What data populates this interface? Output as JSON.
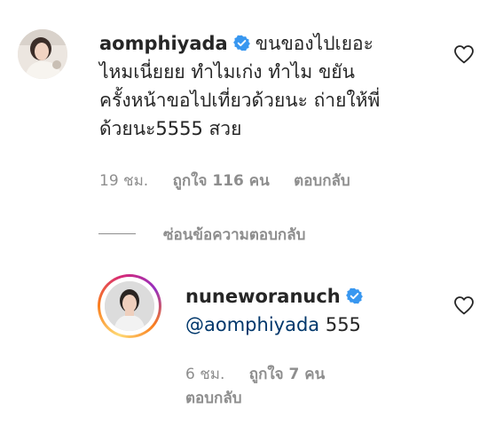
{
  "comment": {
    "username": "aomphiyada",
    "text_line1": "ขนของไปเยอะ",
    "text_line2": "ไหมเนี่ยยย ทำไมเก่ง ทำไม ขยัน",
    "text_line3": "ครั้งหน้าขอไปเที่ยวด้วยนะ ถ่ายให้พี่",
    "text_line4": "ด้วยนะ5555 สวย",
    "time": "19 ชม.",
    "likes": "ถูกใจ 116 คน",
    "reply_label": "ตอบกลับ"
  },
  "hide_replies_label": "ซ่อนข้อความตอบกลับ",
  "reply": {
    "username": "nuneworanuch",
    "mention": "@aomphiyada",
    "text": " 555",
    "time": "6 ชม.",
    "likes": "ถูกใจ 7 คน",
    "reply_label": "ตอบกลับ"
  },
  "icons": {
    "verified": "verified-badge-icon",
    "heart": "heart-outline-icon"
  },
  "colors": {
    "verified_blue": "#3897f0",
    "meta_gray": "#8e8e8e",
    "mention_blue": "#00376b"
  }
}
